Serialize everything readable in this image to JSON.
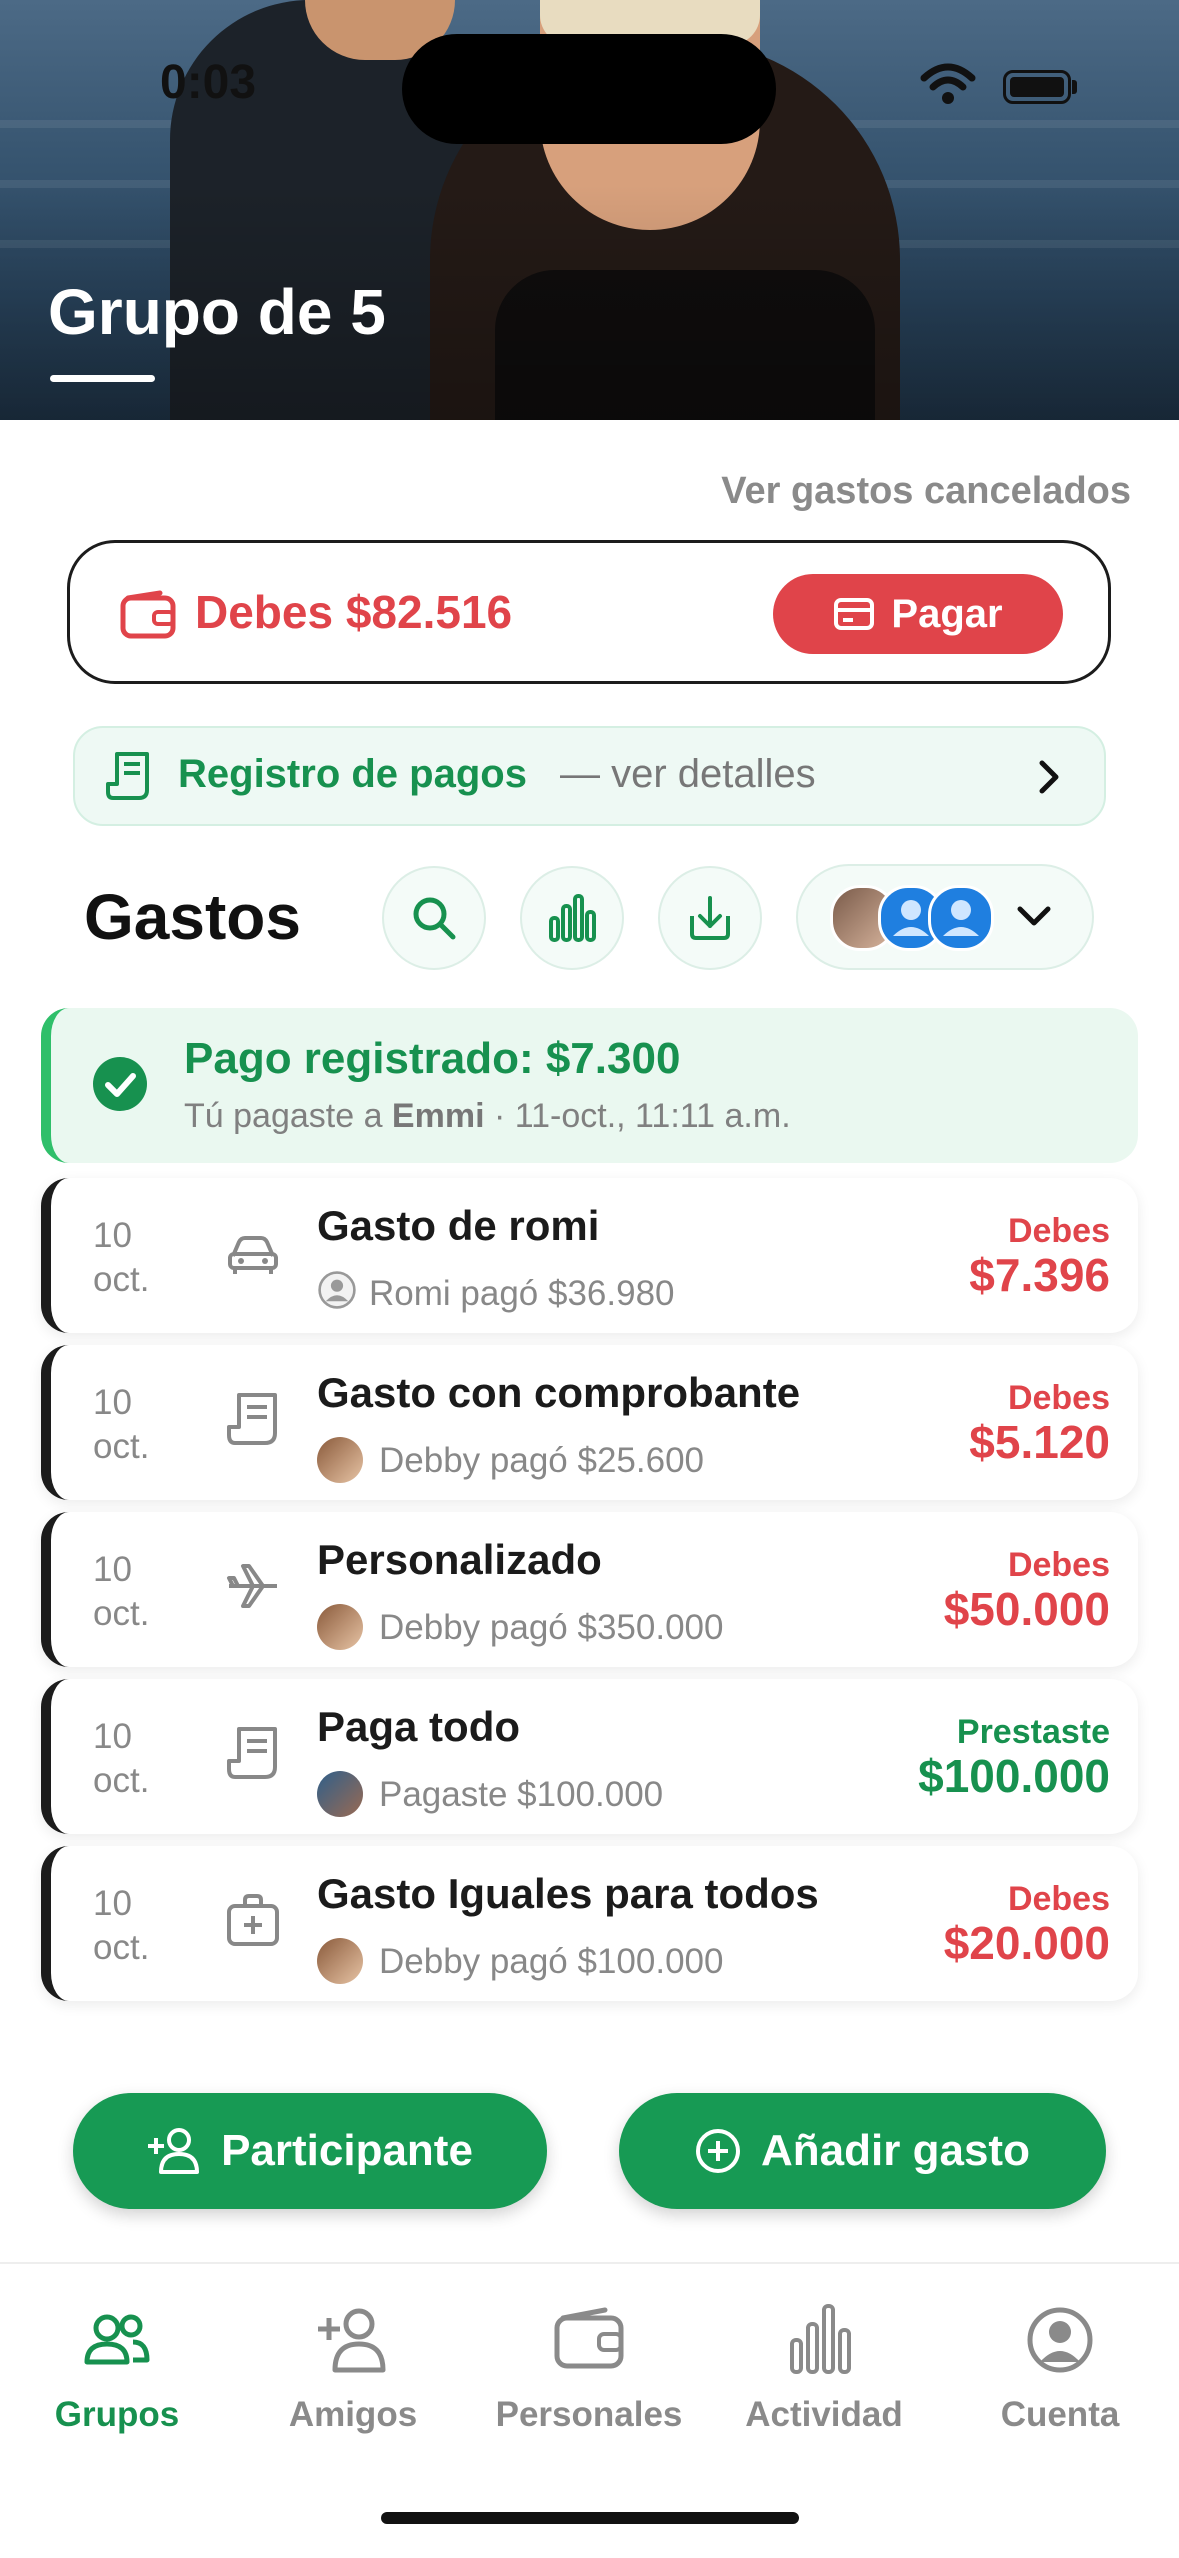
{
  "status_bar": {
    "time": "0:03"
  },
  "header": {
    "title": "Grupo de 5"
  },
  "links": {
    "cancelled": "Ver gastos cancelados"
  },
  "debt_card": {
    "text": "Debes $82.516",
    "pay_label": "Pagar"
  },
  "payments_log": {
    "label": "Registro de pagos",
    "detail": "— ver detalles"
  },
  "expenses": {
    "heading": "Gastos",
    "payment_notice": {
      "title": "Pago registrado: $7.300",
      "sub_prefix": "Tú pagaste a ",
      "sub_name": "Emmi",
      "sub_suffix": " · 11-oct., 11:11 a.m."
    },
    "rows": [
      {
        "day": "10",
        "month": "oct.",
        "icon": "car-icon",
        "title": "Gasto de romi",
        "payer": "Romi pagó $36.980",
        "status": "Debes",
        "amount": "$7.396",
        "tone": "red"
      },
      {
        "day": "10",
        "month": "oct.",
        "icon": "receipt-icon",
        "title": "Gasto con comprobante",
        "payer": "Debby  pagó $25.600",
        "status": "Debes",
        "amount": "$5.120",
        "tone": "red"
      },
      {
        "day": "10",
        "month": "oct.",
        "icon": "airplane-icon",
        "title": "Personalizado",
        "payer": "Debby  pagó $350.000",
        "status": "Debes",
        "amount": "$50.000",
        "tone": "red"
      },
      {
        "day": "10",
        "month": "oct.",
        "icon": "receipt-icon",
        "title": "Paga todo",
        "payer": "Pagaste $100.000",
        "status": "Prestaste",
        "amount": "$100.000",
        "tone": "green"
      },
      {
        "day": "10",
        "month": "oct.",
        "icon": "medkit-icon",
        "title": "Gasto Iguales para todos",
        "payer": "Debby  pagó $100.000",
        "status": "Debes",
        "amount": "$20.000",
        "tone": "red"
      }
    ]
  },
  "actions": {
    "participant": "Participante",
    "add_expense": "Añadir gasto"
  },
  "tabs": [
    {
      "label": "Grupos",
      "active": true
    },
    {
      "label": "Amigos",
      "active": false
    },
    {
      "label": "Personales",
      "active": false
    },
    {
      "label": "Actividad",
      "active": false
    },
    {
      "label": "Cuenta",
      "active": false
    }
  ],
  "colors": {
    "brand_green": "#179a54",
    "debt_red": "#e0444a",
    "text_dark": "#1b1b1b"
  }
}
